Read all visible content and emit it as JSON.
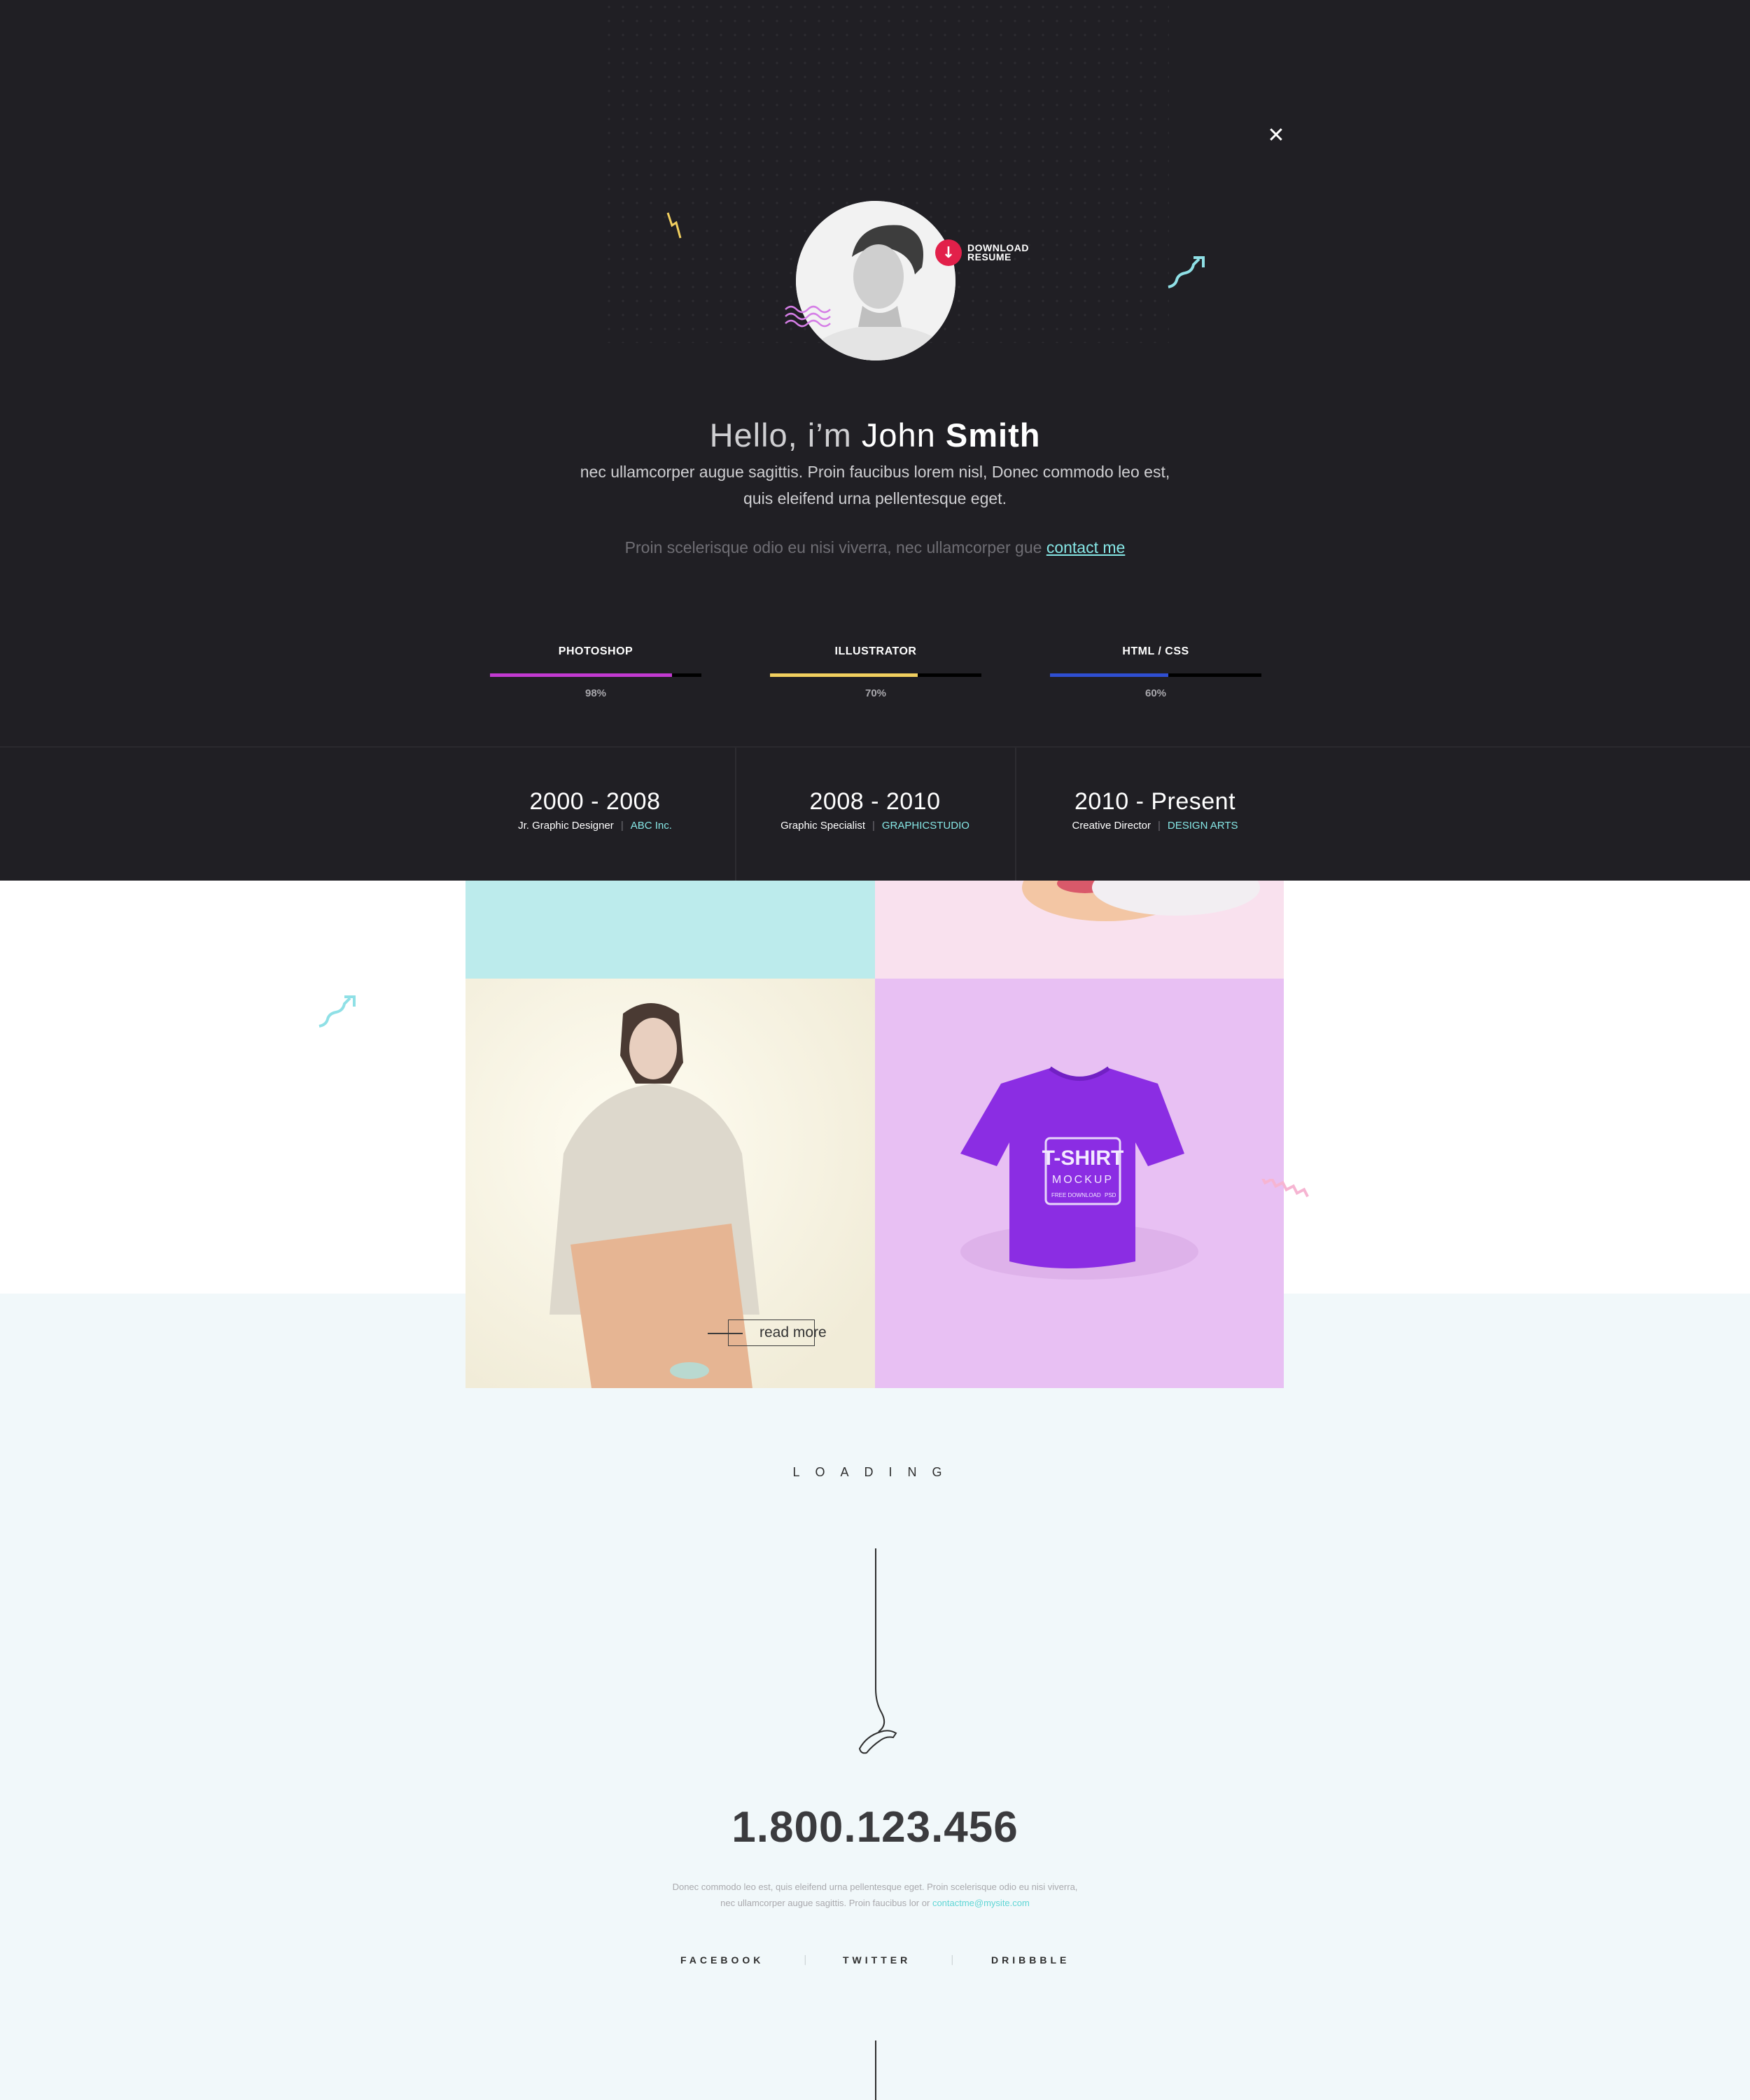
{
  "overlay": {
    "download_label_1": "DOWNLOAD",
    "download_label_2": "RESUME",
    "hello_prefix": "Hello, i’m",
    "hello_first": "John",
    "hello_last": "Smith",
    "intro_line1": "nec ullamcorper augue sagittis. Proin faucibus lorem nisl, Donec commodo leo est,",
    "intro_line2": "quis eleifend urna pellentesque eget.",
    "contact_prefix": "Proin scelerisque odio eu nisi viverra, nec ullamcorper gue",
    "contact_link": "contact me",
    "skills": [
      {
        "name": "PHOTOSHOP",
        "percent_label": "98%",
        "level": 0.86,
        "color": "#c23ad1"
      },
      {
        "name": "ILLUSTRATOR",
        "percent_label": "70%",
        "level": 0.7,
        "color": "#f1cf5f"
      },
      {
        "name": "HTML / CSS",
        "percent_label": "60%",
        "level": 0.56,
        "color": "#2f4fd2"
      }
    ],
    "jobs": [
      {
        "years": "2000 - 2008",
        "title": "Jr. Graphic Designer",
        "company": "ABC Inc."
      },
      {
        "years": "2008 - 2010",
        "title": "Graphic Specialist",
        "company": "GRAPHICSTUDIO"
      },
      {
        "years": "2010 - Present",
        "title": "Creative Director",
        "company": "DESIGN ARTS"
      }
    ]
  },
  "portfolio": {
    "read_more": "read more",
    "tshirt_title": "T-SHIRT",
    "tshirt_sub": "MOCKUP",
    "tshirt_badge1": "FREE DOWNLOAD",
    "tshirt_badge2": "PSD"
  },
  "loading_text": "LOADING",
  "contact": {
    "phone": "1.800.123.456",
    "text_line1": "Donec commodo leo est, quis eleifend urna pellentesque eget. Proin scelerisque odio eu nisi viverra,",
    "text_line2_prefix": "nec ullamcorper augue sagittis. Proin faucibus lor or",
    "email": "contactme@mysite.com",
    "social": [
      "FACEBOOK",
      "TWITTER",
      "DRIBBBLE"
    ],
    "social_separator": "|"
  },
  "colors": {
    "overlay_bg": "#201f24",
    "accent_cyan": "#86e7e6",
    "accent_red": "#e2204a",
    "light_bg": "#f1f8fa"
  }
}
